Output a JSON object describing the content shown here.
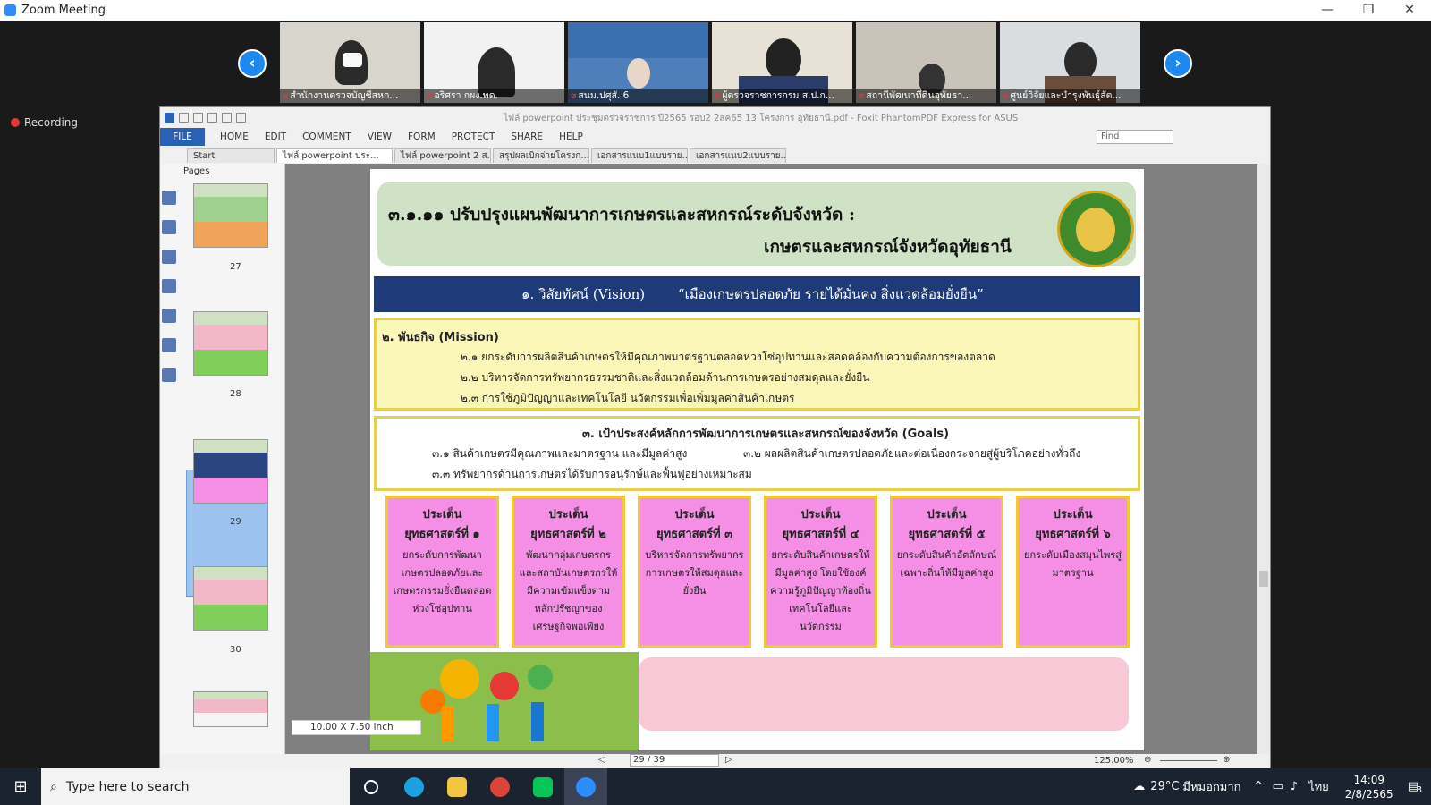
{
  "window": {
    "title": "Zoom Meeting"
  },
  "participants": [
    {
      "name": "สำนักงานตรวจบัญชีสหก..."
    },
    {
      "name": "อริศรา กผง.พด."
    },
    {
      "name": "สนม.ปศุสั. 6"
    },
    {
      "name": "ผู้ตรวจราชการกรม ส.ป.ก..."
    },
    {
      "name": "สถานีพัฒนาที่ดินอุทัยธา..."
    },
    {
      "name": "ศูนย์วิจัยและบำรุงพันธุ์สัต..."
    }
  ],
  "recording": {
    "label": "Recording"
  },
  "pdf": {
    "doc_title": "ไฟล์ powerpoint ประชุมตรวจราชการ ปี2565 รอบ2 2สค65 13 โครงการ อุทัยธานี.pdf - Foxit PhantomPDF Express for ASUS",
    "menu": [
      "FILE",
      "HOME",
      "EDIT",
      "COMMENT",
      "VIEW",
      "FORM",
      "PROTECT",
      "SHARE",
      "HELP"
    ],
    "find_placeholder": "Find",
    "tabs": [
      "Start",
      "ไฟล์ powerpoint ประ...",
      "ไฟล์ powerpoint 2 ส...",
      "สรุปผลเบิกจ่ายโครงก...",
      "เอกสารแนบ1แบบราย...",
      "เอกสารแนบ2แบบราย..."
    ],
    "pages_label": "Pages",
    "thumbs": [
      "27",
      "28",
      "29",
      "30"
    ],
    "size_info": "10.00 X 7.50 inch",
    "page_box": "29 / 39",
    "zoom": "125.00%"
  },
  "slide": {
    "title_line1": "๓.๑.๑๑ ปรับปรุงแผนพัฒนาการเกษตรและสหกรณ์ระดับจังหวัด :",
    "title_line2": "เกษตรและสหกรณ์จังหวัดอุทัยธานี",
    "vision_label": "๑. วิสัยทัศน์ (Vision)",
    "vision_text": "“เมืองเกษตรปลอดภัย  รายได้มั่นคง  สิ่งแวดล้อมยั่งยืน”",
    "mission_title": "๒. พันธกิจ (Mission)",
    "missions": [
      "๒.๑ ยกระดับการผลิตสินค้าเกษตรให้มีคุณภาพมาตรฐานตลอดห่วงโซ่อุปทานและสอดคล้องกับความต้องการของตลาด",
      "๒.๒ บริหารจัดการทรัพยากรธรรมชาติและสิ่งแวดล้อมด้านการเกษตรอย่างสมดุลและยั่งยืน",
      "๒.๓ การใช้ภูมิปัญญาและเทคโนโลยี นวัตกรรมเพื่อเพิ่มมูลค่าสินค้าเกษตร"
    ],
    "goals_title": "๓. เป้าประสงค์หลักการพัฒนาการเกษตรและสหกรณ์ของจังหวัด (Goals)",
    "goals": [
      "๓.๑ สินค้าเกษตรมีคุณภาพและมาตรฐาน และมีมูลค่าสูง",
      "๓.๒ ผลผลิตสินค้าเกษตรปลอดภัยและต่อเนื่องกระจายสู่ผู้บริโภคอย่างทั่วถึง",
      "๓.๓ ทรัพยากรด้านการเกษตรได้รับการอนุรักษ์และฟื้นฟูอย่างเหมาะสม"
    ],
    "strategies": [
      {
        "t1": "ประเด็น",
        "t2": "ยุทธศาสตร์ที่ ๑",
        "desc": "ยกระดับการพัฒนาเกษตรปลอดภัยและเกษตรกรรมยั่งยืนตลอดห่วงโซ่อุปทาน"
      },
      {
        "t1": "ประเด็น",
        "t2": "ยุทธศาสตร์ที่ ๒",
        "desc": "พัฒนากลุ่มเกษตรกรและสถาบันเกษตรกรให้มีความเข้มแข็งตามหลักปรัชญาของเศรษฐกิจพอเพียง"
      },
      {
        "t1": "ประเด็น",
        "t2": "ยุทธศาสตร์ที่ ๓",
        "desc": "บริหารจัดการทรัพยากรการเกษตรให้สมดุลและยั่งยืน"
      },
      {
        "t1": "ประเด็น",
        "t2": "ยุทธศาสตร์ที่ ๔",
        "desc": "ยกระดับสินค้าเกษตรให้มีมูลค่าสูง โดยใช้องค์ความรู้ภูมิปัญญาท้องถิ่น เทคโนโลยีและนวัตกรรม"
      },
      {
        "t1": "ประเด็น",
        "t2": "ยุทธศาสตร์ที่ ๕",
        "desc": "ยกระดับสินค้าอัตลักษณ์เฉพาะถิ่นให้มีมูลค่าสูง"
      },
      {
        "t1": "ประเด็น",
        "t2": "ยุทธศาสตร์ที่ ๖",
        "desc": "ยกระดับเมืองสมุนไพรสู่มาตรฐาน"
      }
    ]
  },
  "taskbar": {
    "search_placeholder": "Type here to search",
    "weather": "29°C",
    "weather_text": "มีหมอกมาก",
    "lang": "ไทย",
    "time": "14:09",
    "date": "2/8/2565",
    "notifications": "3"
  }
}
